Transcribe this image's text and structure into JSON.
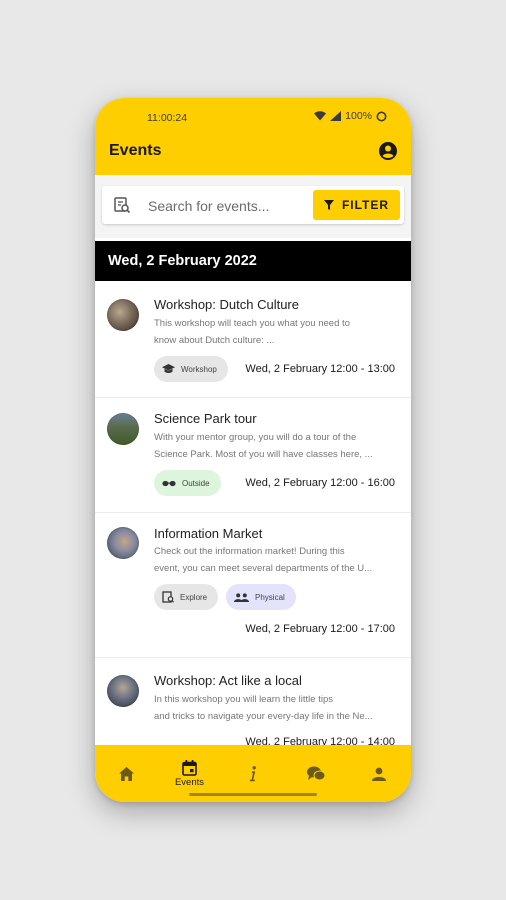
{
  "status": {
    "time": "11:00:24",
    "battery": "100%"
  },
  "app": {
    "title": "Events"
  },
  "search": {
    "placeholder": "Search for events...",
    "filter_label": "FILTER"
  },
  "date_header": "Wed, 2 February 2022",
  "events": [
    {
      "title": "Workshop: Dutch Culture",
      "desc_lines": [
        "This workshop will teach you what you need to",
        "know about Dutch culture: ..."
      ],
      "chips": [
        {
          "icon": "graduation-cap-icon",
          "label": "Workshop",
          "color": "#e6e6e6"
        }
      ],
      "time": "Wed, 2 February 12:00 - 13:00"
    },
    {
      "title": "Science Park tour",
      "desc_lines": [
        "With your mentor group, you will do a tour of the",
        "Science Park. Most of you will have classes here, ..."
      ],
      "chips": [
        {
          "icon": "sunglasses-icon",
          "label": "Outside",
          "color": "#dcf5dc"
        }
      ],
      "time": "Wed, 2 February 12:00 - 16:00"
    },
    {
      "title": "Information Market",
      "desc_lines": [
        "Check out the information market! During this",
        "event, you can meet several departments of the U..."
      ],
      "chips": [
        {
          "icon": "explore-icon",
          "label": "Explore",
          "color": "#e6e6e6"
        },
        {
          "icon": "people-icon",
          "label": "Physical",
          "color": "#e3e3fb"
        }
      ],
      "time": "Wed, 2 February 12:00 - 17:00"
    },
    {
      "title": "Workshop: Act like a local",
      "desc_lines": [
        "In this workshop you will learn the little tips",
        "and tricks to navigate your every-day life in the Ne..."
      ],
      "chips": [],
      "time": "Wed, 2 February 12:00 - 14:00"
    }
  ],
  "nav": {
    "items": [
      {
        "name": "home",
        "label": ""
      },
      {
        "name": "events",
        "label": "Events"
      },
      {
        "name": "info",
        "label": ""
      },
      {
        "name": "chat",
        "label": ""
      },
      {
        "name": "profile",
        "label": ""
      }
    ]
  },
  "colors": {
    "accent": "#ffce00",
    "header_bg": "#000000"
  }
}
